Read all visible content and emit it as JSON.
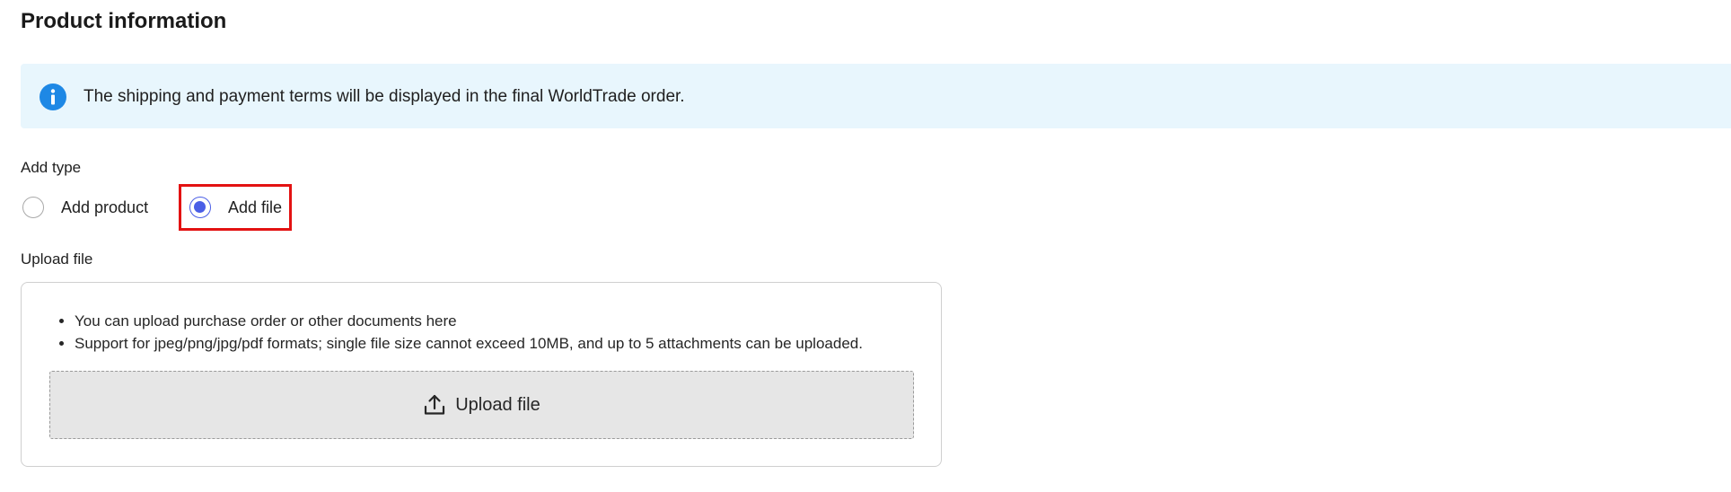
{
  "page": {
    "title": "Product information"
  },
  "banner": {
    "icon": "info-icon",
    "icon_color": "#1e88e5",
    "background": "#e8f6fd",
    "text": "The shipping and payment terms will be displayed in the final WorldTrade order."
  },
  "add_type": {
    "label": "Add type",
    "options": [
      {
        "label": "Add product",
        "selected": false
      },
      {
        "label": "Add file",
        "selected": true
      }
    ],
    "accent_color": "#4a5ee6",
    "highlight_color": "#e31212"
  },
  "upload": {
    "label": "Upload file",
    "hints": [
      "You can upload purchase order or other documents here",
      "Support for jpeg/png/jpg/pdf formats; single file size cannot exceed 10MB, and up to 5 attachments can be uploaded."
    ],
    "button_label": "Upload file",
    "button_icon": "upload-icon"
  }
}
